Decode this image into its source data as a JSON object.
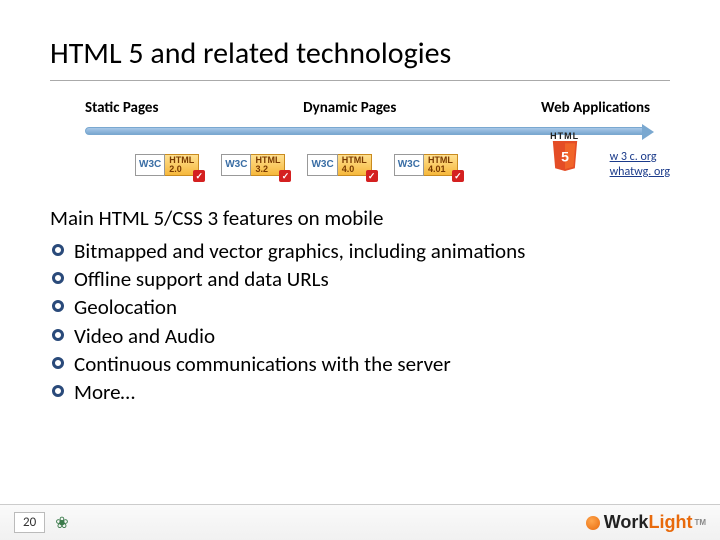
{
  "title": "HTML 5 and related technologies",
  "columns": [
    "Static Pages",
    "Dynamic Pages",
    "Web Applications"
  ],
  "badges": [
    {
      "w3c": "W3C",
      "top": "HTML",
      "ver": "2.0"
    },
    {
      "w3c": "W3C",
      "top": "HTML",
      "ver": "3.2"
    },
    {
      "w3c": "W3C",
      "top": "HTML",
      "ver": "4.0"
    },
    {
      "w3c": "W3C",
      "top": "HTML",
      "ver": "4.01"
    }
  ],
  "html5_label": "HTML",
  "html5_num": "5",
  "links": [
    "w 3 c. org",
    "whatwg. org"
  ],
  "subheading": "Main HTML 5/CSS 3 features on mobile",
  "features": [
    "Bitmapped and vector graphics, including animations",
    "Offline support and data URLs",
    "Geolocation",
    "Video and Audio",
    "Continuous communications with the server",
    "More…"
  ],
  "page_num": "20",
  "brand": {
    "work": "Work",
    "light": "Light",
    "tm": "TM"
  }
}
